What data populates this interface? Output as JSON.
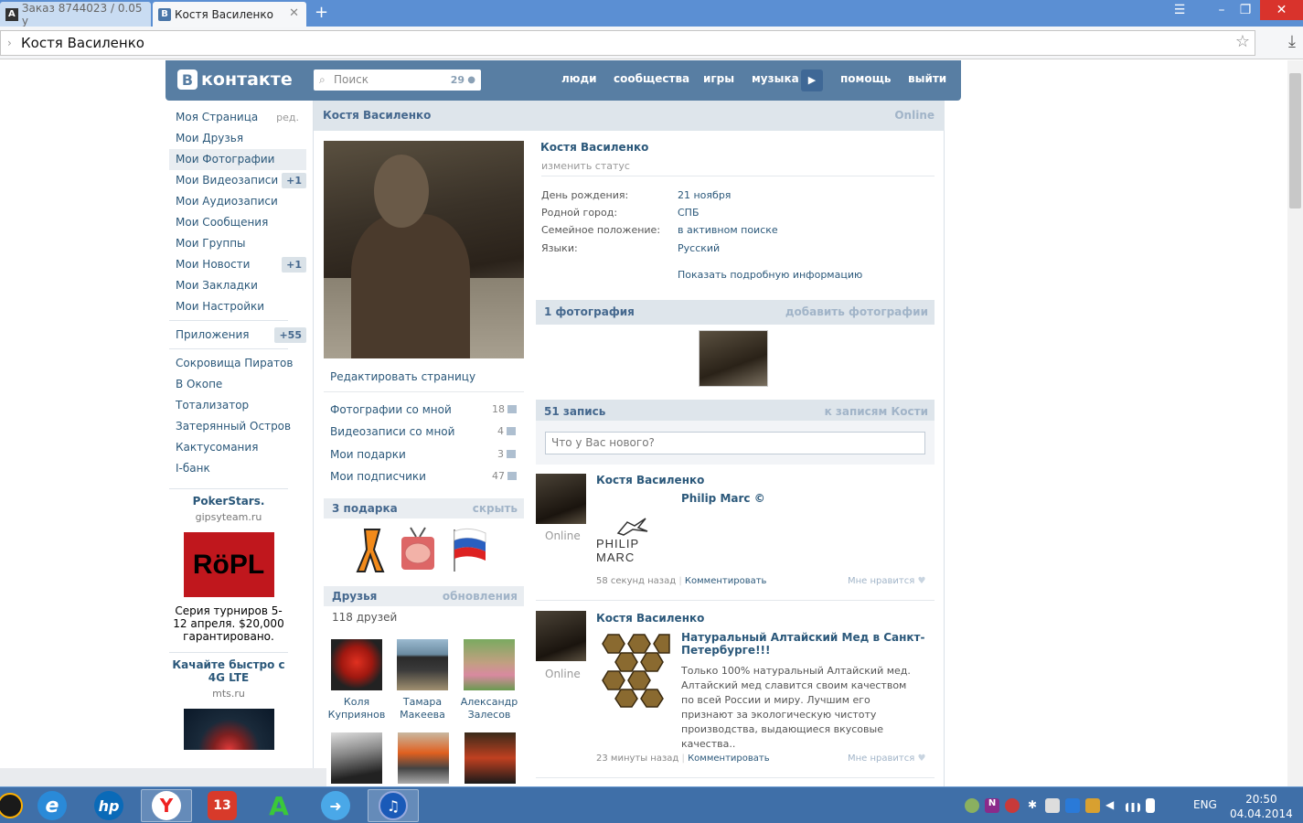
{
  "browser": {
    "tabs": [
      {
        "favicon": "A",
        "label": "Заказ 8744023 / 0.05 у"
      },
      {
        "favicon": "В",
        "label": "Костя Василенко"
      }
    ],
    "address": "Костя Василенко"
  },
  "vk": {
    "logo": "контакте",
    "logo_letter": "В",
    "search_placeholder": "Поиск",
    "search_count": "29",
    "nav": [
      "люди",
      "сообщества",
      "игры",
      "музыка",
      "помощь",
      "выйти"
    ]
  },
  "leftmenu": {
    "items": [
      {
        "label": "Моя Страница",
        "extra": "ред."
      },
      {
        "label": "Мои Друзья"
      },
      {
        "label": "Мои Фотографии"
      },
      {
        "label": "Мои Видеозаписи",
        "badge": "+1"
      },
      {
        "label": "Мои Аудиозаписи"
      },
      {
        "label": "Мои Сообщения"
      },
      {
        "label": "Мои Группы"
      },
      {
        "label": "Мои Новости",
        "badge": "+1"
      },
      {
        "label": "Мои Закладки"
      },
      {
        "label": "Мои Настройки"
      }
    ],
    "apps": {
      "label": "Приложения",
      "badge": "+55"
    },
    "games": [
      "Сокровища Пиратов",
      "В Окопе",
      "Тотализатор",
      "Затерянный Остров",
      "Кактусомания",
      "I-банк"
    ],
    "ad1": {
      "title": "PokerStars.",
      "url": "gipsyteam.ru",
      "logo": "RöPL",
      "text": "Серия турниров 5-12 апреля. $20,000 гарантировано."
    },
    "ad2": {
      "title": "Качайте быстро с 4G LTE",
      "url": "mts.ru"
    }
  },
  "profile": {
    "title": "Костя Василенко",
    "online": "Online",
    "name": "Костя Василенко",
    "status": "изменить статус",
    "info": [
      {
        "label": "День рождения:",
        "value": "21 ноября"
      },
      {
        "label": "Родной город:",
        "value": "СПБ"
      },
      {
        "label": "Семейное положение:",
        "value": "в активном поиске"
      },
      {
        "label": "Языки:",
        "value": "Русский"
      }
    ],
    "show_more": "Показать подробную информацию",
    "edit_page": "Редактировать страницу",
    "sidelinks": [
      {
        "label": "Фотографии со мной",
        "count": "18"
      },
      {
        "label": "Видеозаписи со мной",
        "count": "4"
      },
      {
        "label": "Мои подарки",
        "count": "3"
      },
      {
        "label": "Мои подписчики",
        "count": "47"
      }
    ],
    "gifts": {
      "title": "3 подарка",
      "action": "скрыть"
    },
    "friends": {
      "title": "Друзья",
      "action": "обновления",
      "count": "118 друзей",
      "list": [
        {
          "first": "Коля",
          "last": "Куприянов"
        },
        {
          "first": "Тамара",
          "last": "Макеева"
        },
        {
          "first": "Александр",
          "last": "Залесов"
        }
      ]
    },
    "photos": {
      "title": "1 фотография",
      "action": "добавить фотографии"
    },
    "wall": {
      "title": "51 запись",
      "action": "к записям Кости",
      "placeholder": "Что у Вас нового?"
    },
    "posts": [
      {
        "author": "Костя Василенко",
        "online": "Online",
        "title": "Philip Marc ©",
        "logo": "PHILIP MARC",
        "time": "58 секунд назад",
        "comment": "Комментировать",
        "like": "Мне нравится"
      },
      {
        "author": "Костя Василенко",
        "online": "Online",
        "title": "Натуральный Алтайский Мед в Санкт-Петербурге!!!",
        "text": "Только 100% натуральный Алтайский мед. Алтайский мед славится своим качеством по всей России и миру. Лучшим его признают за экологическую чистоту производства, выдающиеся вкусовые качества..",
        "time": "23 минуты назад",
        "comment": "Комментировать",
        "like": "Мне нравится"
      }
    ]
  },
  "taskbar": {
    "lang": "ENG",
    "time": "20:50",
    "date": "04.04.2014"
  },
  "colors": {
    "vk_blue": "#587ea3",
    "link": "#2b587a",
    "header_text": "#45688e"
  }
}
